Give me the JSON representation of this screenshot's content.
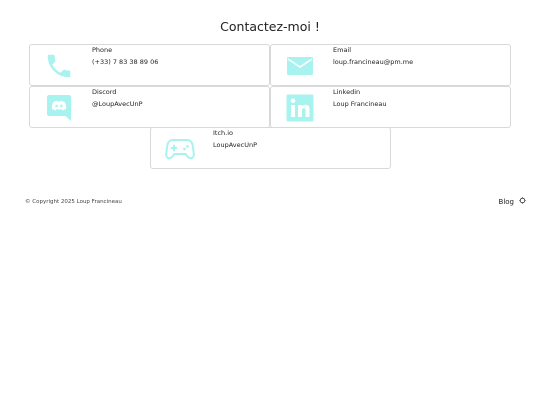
{
  "page": {
    "title": "Contactez-moi !"
  },
  "contacts": [
    {
      "label": "Phone",
      "value": "(+33) 7 83 38 89 06",
      "icon": "phone-icon"
    },
    {
      "label": "Email",
      "value": "loup.francineau@pm.me",
      "icon": "mail-icon"
    },
    {
      "label": "Discord",
      "value": "@LoupAvecUnP",
      "icon": "discord-icon"
    },
    {
      "label": "Linkedin",
      "value": "Loup Francineau",
      "icon": "linkedin-icon"
    },
    {
      "label": "Itch.io",
      "value": "LoupAvecUnP",
      "icon": "gamepad-icon"
    }
  ],
  "footer": {
    "copyright": "© Copyright 2025 Loup Francineau",
    "blog_label": "Blog",
    "blog_icon": "rss-icon"
  },
  "colors": {
    "icon_accent": "#a8f3ef",
    "card_border": "#d9d9d9"
  }
}
